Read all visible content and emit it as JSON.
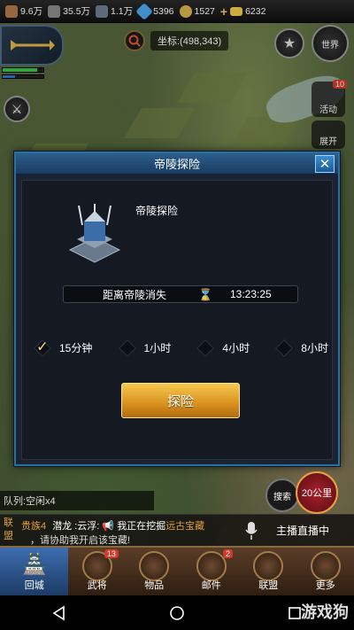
{
  "resources": [
    {
      "icon": "wood-icon",
      "value": "9.6万",
      "color": "#b07a4a"
    },
    {
      "icon": "weapon-icon",
      "value": "35.5万",
      "color": "#8a8a8a"
    },
    {
      "icon": "iron-icon",
      "value": "1.1万",
      "color": "#6d7d8f"
    },
    {
      "icon": "crystal-icon",
      "value": "5396",
      "color": "#4aa8f0"
    },
    {
      "icon": "coin-icon",
      "value": "1527",
      "color": "#d8b24a"
    },
    {
      "icon": "gold-ingot-icon",
      "value": "6232",
      "color": "#f2c94c"
    }
  ],
  "coordinates": "坐标:(498,343)",
  "world_button": "世界",
  "activity": {
    "label": "活动",
    "badge": "10"
  },
  "expand_label": "展开",
  "dialog": {
    "title": "帝陵探险",
    "tomb_name": "帝陵探险",
    "timer_label": "距离帝陵消失",
    "timer_value": "13:23:25",
    "options": [
      {
        "label": "15分钟",
        "checked": true
      },
      {
        "label": "1小时",
        "checked": false
      },
      {
        "label": "4小时",
        "checked": false
      },
      {
        "label": "8小时",
        "checked": false
      }
    ],
    "explore_label": "探险"
  },
  "queue": "队列:空闲x4",
  "search_label": "搜索",
  "distance": "20公里",
  "chat": {
    "tag": "联盟",
    "line1_prefix": "贵族4",
    "line1_name": "潜龙 :云浮:",
    "line1_text": "我正在挖掘",
    "line1_highlight": "远古宝藏",
    "line2": "，请协助我开启该宝藏!",
    "live": "主播直播中"
  },
  "menu": [
    {
      "label": "回城",
      "badge": ""
    },
    {
      "label": "武将",
      "badge": "13"
    },
    {
      "label": "物品",
      "badge": ""
    },
    {
      "label": "邮件",
      "badge": "2"
    },
    {
      "label": "联盟",
      "badge": ""
    },
    {
      "label": "更多",
      "badge": ""
    }
  ],
  "watermark": "游戏狗"
}
